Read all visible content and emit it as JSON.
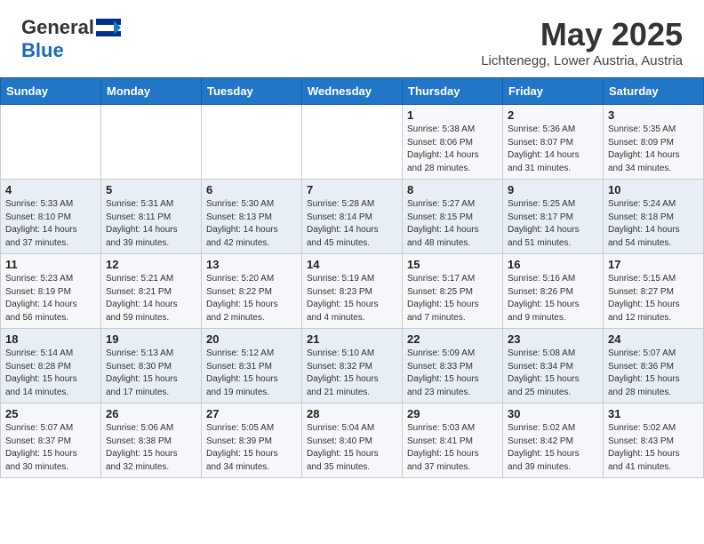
{
  "header": {
    "logo_general": "General",
    "logo_blue": "Blue",
    "month_title": "May 2025",
    "location": "Lichtenegg, Lower Austria, Austria"
  },
  "days_of_week": [
    "Sunday",
    "Monday",
    "Tuesday",
    "Wednesday",
    "Thursday",
    "Friday",
    "Saturday"
  ],
  "weeks": [
    [
      {
        "day": "",
        "info": ""
      },
      {
        "day": "",
        "info": ""
      },
      {
        "day": "",
        "info": ""
      },
      {
        "day": "",
        "info": ""
      },
      {
        "day": "1",
        "info": "Sunrise: 5:38 AM\nSunset: 8:06 PM\nDaylight: 14 hours\nand 28 minutes."
      },
      {
        "day": "2",
        "info": "Sunrise: 5:36 AM\nSunset: 8:07 PM\nDaylight: 14 hours\nand 31 minutes."
      },
      {
        "day": "3",
        "info": "Sunrise: 5:35 AM\nSunset: 8:09 PM\nDaylight: 14 hours\nand 34 minutes."
      }
    ],
    [
      {
        "day": "4",
        "info": "Sunrise: 5:33 AM\nSunset: 8:10 PM\nDaylight: 14 hours\nand 37 minutes."
      },
      {
        "day": "5",
        "info": "Sunrise: 5:31 AM\nSunset: 8:11 PM\nDaylight: 14 hours\nand 39 minutes."
      },
      {
        "day": "6",
        "info": "Sunrise: 5:30 AM\nSunset: 8:13 PM\nDaylight: 14 hours\nand 42 minutes."
      },
      {
        "day": "7",
        "info": "Sunrise: 5:28 AM\nSunset: 8:14 PM\nDaylight: 14 hours\nand 45 minutes."
      },
      {
        "day": "8",
        "info": "Sunrise: 5:27 AM\nSunset: 8:15 PM\nDaylight: 14 hours\nand 48 minutes."
      },
      {
        "day": "9",
        "info": "Sunrise: 5:25 AM\nSunset: 8:17 PM\nDaylight: 14 hours\nand 51 minutes."
      },
      {
        "day": "10",
        "info": "Sunrise: 5:24 AM\nSunset: 8:18 PM\nDaylight: 14 hours\nand 54 minutes."
      }
    ],
    [
      {
        "day": "11",
        "info": "Sunrise: 5:23 AM\nSunset: 8:19 PM\nDaylight: 14 hours\nand 56 minutes."
      },
      {
        "day": "12",
        "info": "Sunrise: 5:21 AM\nSunset: 8:21 PM\nDaylight: 14 hours\nand 59 minutes."
      },
      {
        "day": "13",
        "info": "Sunrise: 5:20 AM\nSunset: 8:22 PM\nDaylight: 15 hours\nand 2 minutes."
      },
      {
        "day": "14",
        "info": "Sunrise: 5:19 AM\nSunset: 8:23 PM\nDaylight: 15 hours\nand 4 minutes."
      },
      {
        "day": "15",
        "info": "Sunrise: 5:17 AM\nSunset: 8:25 PM\nDaylight: 15 hours\nand 7 minutes."
      },
      {
        "day": "16",
        "info": "Sunrise: 5:16 AM\nSunset: 8:26 PM\nDaylight: 15 hours\nand 9 minutes."
      },
      {
        "day": "17",
        "info": "Sunrise: 5:15 AM\nSunset: 8:27 PM\nDaylight: 15 hours\nand 12 minutes."
      }
    ],
    [
      {
        "day": "18",
        "info": "Sunrise: 5:14 AM\nSunset: 8:28 PM\nDaylight: 15 hours\nand 14 minutes."
      },
      {
        "day": "19",
        "info": "Sunrise: 5:13 AM\nSunset: 8:30 PM\nDaylight: 15 hours\nand 17 minutes."
      },
      {
        "day": "20",
        "info": "Sunrise: 5:12 AM\nSunset: 8:31 PM\nDaylight: 15 hours\nand 19 minutes."
      },
      {
        "day": "21",
        "info": "Sunrise: 5:10 AM\nSunset: 8:32 PM\nDaylight: 15 hours\nand 21 minutes."
      },
      {
        "day": "22",
        "info": "Sunrise: 5:09 AM\nSunset: 8:33 PM\nDaylight: 15 hours\nand 23 minutes."
      },
      {
        "day": "23",
        "info": "Sunrise: 5:08 AM\nSunset: 8:34 PM\nDaylight: 15 hours\nand 25 minutes."
      },
      {
        "day": "24",
        "info": "Sunrise: 5:07 AM\nSunset: 8:36 PM\nDaylight: 15 hours\nand 28 minutes."
      }
    ],
    [
      {
        "day": "25",
        "info": "Sunrise: 5:07 AM\nSunset: 8:37 PM\nDaylight: 15 hours\nand 30 minutes."
      },
      {
        "day": "26",
        "info": "Sunrise: 5:06 AM\nSunset: 8:38 PM\nDaylight: 15 hours\nand 32 minutes."
      },
      {
        "day": "27",
        "info": "Sunrise: 5:05 AM\nSunset: 8:39 PM\nDaylight: 15 hours\nand 34 minutes."
      },
      {
        "day": "28",
        "info": "Sunrise: 5:04 AM\nSunset: 8:40 PM\nDaylight: 15 hours\nand 35 minutes."
      },
      {
        "day": "29",
        "info": "Sunrise: 5:03 AM\nSunset: 8:41 PM\nDaylight: 15 hours\nand 37 minutes."
      },
      {
        "day": "30",
        "info": "Sunrise: 5:02 AM\nSunset: 8:42 PM\nDaylight: 15 hours\nand 39 minutes."
      },
      {
        "day": "31",
        "info": "Sunrise: 5:02 AM\nSunset: 8:43 PM\nDaylight: 15 hours\nand 41 minutes."
      }
    ]
  ]
}
